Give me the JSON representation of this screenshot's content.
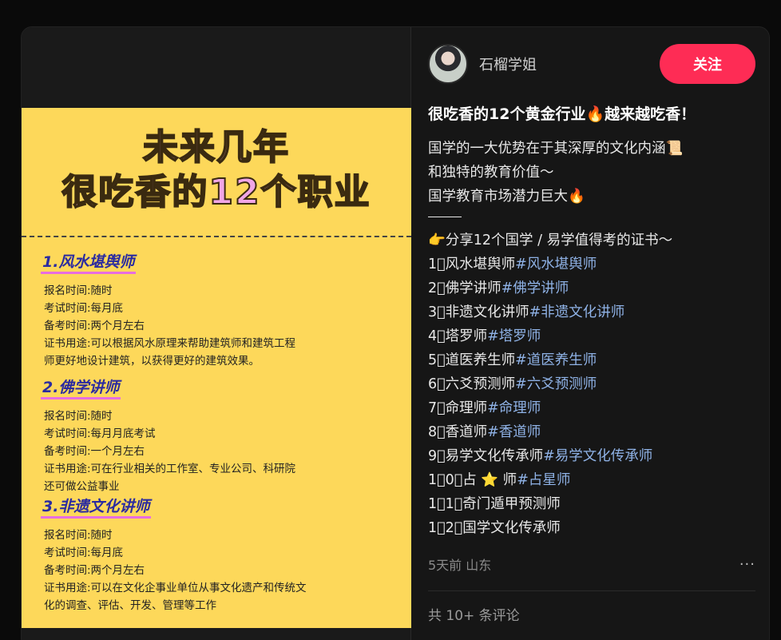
{
  "author": {
    "name": "石榴学姐"
  },
  "follow_label": "关注",
  "post": {
    "title": "很吃香的12个黄金行业🔥越来越吃香！",
    "intro": [
      "国学的一大优势在于其深厚的文化内涵📜",
      "和独特的教育价值～",
      "国学教育市场潜力巨大🔥"
    ],
    "share_line": "👉分享12个国学 / 易学值得考的证书～",
    "items": [
      {
        "text": "1⃣风水堪舆师",
        "tag": "#风水堪舆师"
      },
      {
        "text": "2⃣佛学讲师",
        "tag": "#佛学讲师"
      },
      {
        "text": "3⃣非遗文化讲师",
        "tag": "#非遗文化讲师"
      },
      {
        "text": "4⃣塔罗师",
        "tag": "#塔罗师"
      },
      {
        "text": "5⃣道医养生师",
        "tag": "#道医养生师"
      },
      {
        "text": "6⃣六爻预测师",
        "tag": "#六爻预测师"
      },
      {
        "text": "7⃣命理师",
        "tag": "#命理师"
      },
      {
        "text": "8⃣香道师",
        "tag": "#香道师"
      },
      {
        "text": "9⃣易学文化传承师",
        "tag": "#易学文化传承师"
      },
      {
        "text": "1⃣0⃣占 ⭐ 师",
        "tag": "#占星师"
      },
      {
        "text": "1⃣1⃣奇门遁甲预测师",
        "tag": ""
      },
      {
        "text": "1⃣2⃣国学文化传承师",
        "tag": ""
      }
    ]
  },
  "meta": {
    "time_location": "5天前 山东",
    "more": "···"
  },
  "comments_label": "共 10+ 条评论",
  "poster": {
    "title_line1": "未来几年",
    "title_line2": "很吃香的12个职业",
    "jobs": [
      {
        "heading": "1.风水堪舆师",
        "lines": [
          "报名时间:随时",
          "考试时间:每月底",
          "备考时间:两个月左右",
          "证书用途:可以根据风水原理来帮助建筑师和建筑工程",
          "师更好地设计建筑，以获得更好的建筑效果。"
        ]
      },
      {
        "heading": "2.佛学讲师",
        "lines": [
          "报名时间:随时",
          "考试时间:每月月底考试",
          "备考时间:一个月左右",
          "证书用途:可在行业相关的工作室、专业公司、科研院",
          "还可做公益事业"
        ]
      },
      {
        "heading": "3.非遗文化讲师",
        "lines": [
          "报名时间:随时",
          "考试时间:每月底",
          "备考时间:两个月左右",
          "证书用途:可以在文化企事业单位从事文化遗产和传统文",
          "化的调查、评估、开发、管理等工作"
        ]
      }
    ]
  },
  "colors": {
    "accent": "#fe2c55",
    "tag": "#8fb2e6",
    "poster_bg": "#fdd85a"
  }
}
